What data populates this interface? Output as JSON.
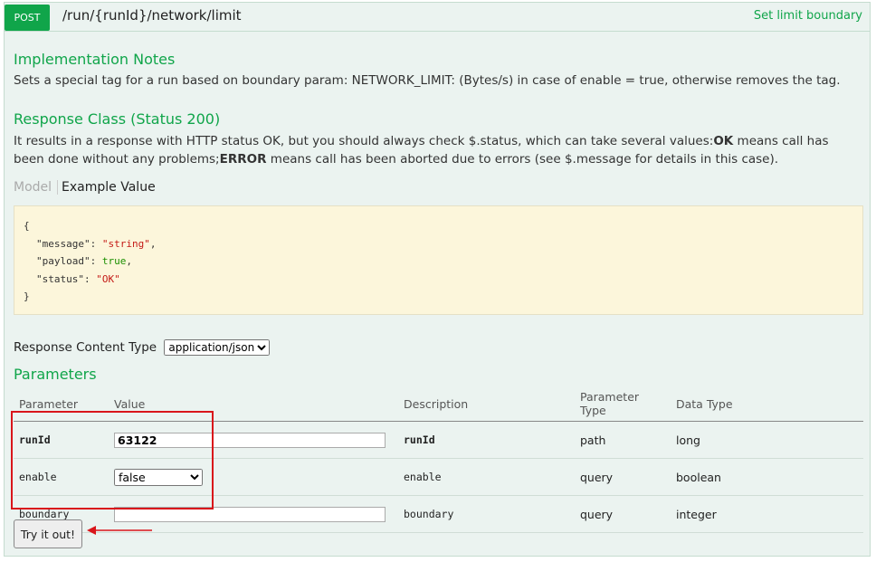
{
  "header": {
    "method": "POST",
    "path": "/run/{runId}/network/limit",
    "summary": "Set limit boundary"
  },
  "implementation": {
    "title": "Implementation Notes",
    "text": "Sets a special tag for a run based on boundary param: NETWORK_LIMIT: (Bytes/s) in case of enable = true, otherwise removes the tag."
  },
  "response_class": {
    "title": "Response Class (Status 200)",
    "text_part1": "It results in a response with HTTP status OK, but you should always check $.status, which can take several values:",
    "ok": "OK",
    "text_part2": " means call has been done without any problems;",
    "error": "ERROR",
    "text_part3": " means call has been aborted due to errors (see $.message for details in this case)."
  },
  "tabs": {
    "model": "Model",
    "example": "Example Value"
  },
  "example": {
    "open": "{",
    "message_key": "\"message\"",
    "message_val": "\"string\"",
    "payload_key": "\"payload\"",
    "payload_val": "true",
    "status_key": "\"status\"",
    "status_val": "\"OK\"",
    "close": "}"
  },
  "content_type": {
    "label": "Response Content Type",
    "selected": "application/json"
  },
  "parameters": {
    "title": "Parameters",
    "headers": [
      "Parameter",
      "Value",
      "Description",
      "Parameter Type",
      "Data Type"
    ],
    "rows": [
      {
        "name": "runId",
        "value": "63122",
        "description": "runId",
        "param_type": "path",
        "data_type": "long"
      },
      {
        "name": "enable",
        "value": "false",
        "description": "enable",
        "param_type": "query",
        "data_type": "boolean"
      },
      {
        "name": "boundary",
        "value": "",
        "description": "boundary",
        "param_type": "query",
        "data_type": "integer"
      }
    ]
  },
  "try_button": "Try it out!",
  "colors": {
    "accent": "#10a54a",
    "highlight": "#d9161b",
    "panel": "#ebf3f0",
    "code_bg": "#fcf6db"
  }
}
